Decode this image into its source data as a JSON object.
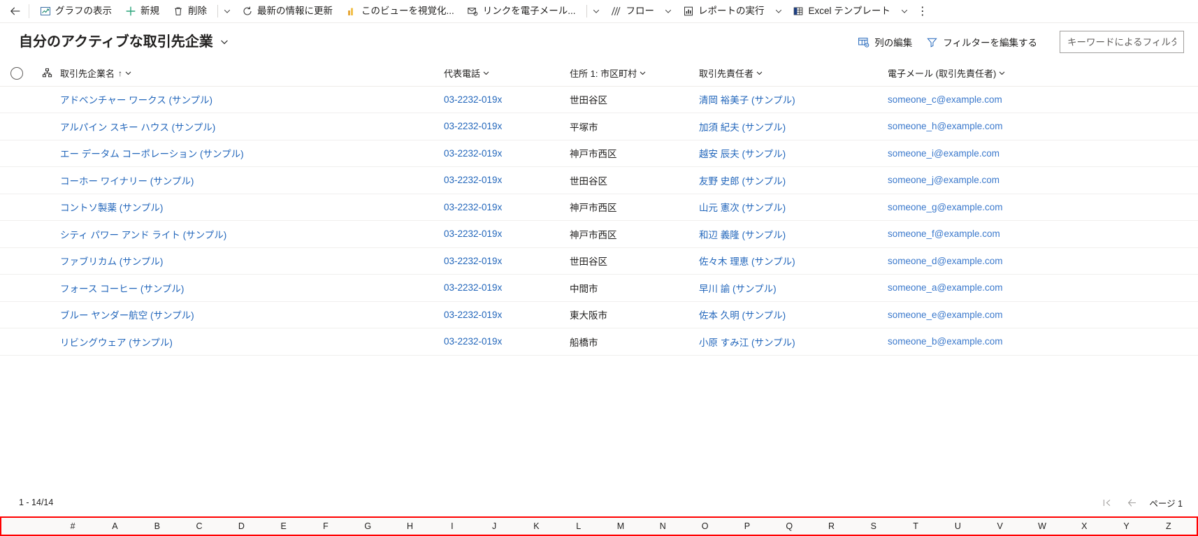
{
  "command_bar": {
    "back_icon": "back-arrow-icon",
    "items": [
      {
        "icon": "chart-icon",
        "label": "グラフの表示",
        "caret": false
      },
      {
        "icon": "plus-icon",
        "label": "新規",
        "caret": false
      },
      {
        "icon": "trash-icon",
        "label": "削除",
        "caret": true
      },
      {
        "icon": "refresh-icon",
        "label": "最新の情報に更新",
        "caret": false
      },
      {
        "icon": "powerbi-icon",
        "label": "このビューを視覚化...",
        "caret": false
      },
      {
        "icon": "email-link-icon",
        "label": "リンクを電子メール...",
        "caret": true
      },
      {
        "icon": "flow-icon",
        "label": "フロー",
        "caret": true
      },
      {
        "icon": "report-icon",
        "label": "レポートの実行",
        "caret": true
      },
      {
        "icon": "excel-icon",
        "label": "Excel テンプレート",
        "caret": true
      }
    ],
    "overflow_label": "⋮"
  },
  "view_header": {
    "title": "自分のアクティブな取引先企業",
    "title_caret_icon": "chevron-down-icon",
    "edit_columns": {
      "icon": "edit-columns-icon",
      "label": "列の編集"
    },
    "edit_filters": {
      "icon": "filter-icon",
      "label": "フィルターを編集する"
    },
    "quick_filter": {
      "value": "",
      "placeholder": "キーワードによるフィルタ"
    }
  },
  "grid": {
    "select_all_icon": "select-all-circle-icon",
    "hierarchy_icon": "hierarchy-icon",
    "columns": [
      {
        "key": "name",
        "label": "取引先企業名",
        "sorted": "asc"
      },
      {
        "key": "phone",
        "label": "代表電話"
      },
      {
        "key": "city",
        "label": "住所 1: 市区町村"
      },
      {
        "key": "contact",
        "label": "取引先責任者"
      },
      {
        "key": "email",
        "label": "電子メール (取引先責任者)"
      }
    ],
    "sort_asc_glyph": "↑",
    "rows": [
      {
        "name": "アドベンチャー ワークス (サンプル)",
        "phone": "03-2232-019x",
        "city": "世田谷区",
        "contact": "清岡 裕美子 (サンプル)",
        "email": "someone_c@example.com"
      },
      {
        "name": "アルパイン スキー ハウス (サンプル)",
        "phone": "03-2232-019x",
        "city": "平塚市",
        "contact": "加須 紀夫 (サンプル)",
        "email": "someone_h@example.com"
      },
      {
        "name": "エー データム コーポレーション (サンプル)",
        "phone": "03-2232-019x",
        "city": "神戸市西区",
        "contact": "越安 辰夫 (サンプル)",
        "email": "someone_i@example.com"
      },
      {
        "name": "コーホー ワイナリー (サンプル)",
        "phone": "03-2232-019x",
        "city": "世田谷区",
        "contact": "友野 史郎 (サンプル)",
        "email": "someone_j@example.com"
      },
      {
        "name": "コントソ製薬 (サンプル)",
        "phone": "03-2232-019x",
        "city": "神戸市西区",
        "contact": "山元 憲次 (サンプル)",
        "email": "someone_g@example.com"
      },
      {
        "name": "シティ パワー アンド ライト (サンプル)",
        "phone": "03-2232-019x",
        "city": "神戸市西区",
        "contact": "和辺 義隆 (サンプル)",
        "email": "someone_f@example.com"
      },
      {
        "name": "ファブリカム (サンプル)",
        "phone": "03-2232-019x",
        "city": "世田谷区",
        "contact": "佐々木 理恵 (サンプル)",
        "email": "someone_d@example.com"
      },
      {
        "name": "フォース コーヒー (サンプル)",
        "phone": "03-2232-019x",
        "city": "中間市",
        "contact": "早川 諭 (サンプル)",
        "email": "someone_a@example.com"
      },
      {
        "name": "ブルー ヤンダー航空 (サンプル)",
        "phone": "03-2232-019x",
        "city": "東大阪市",
        "contact": "佐本 久明 (サンプル)",
        "email": "someone_e@example.com"
      },
      {
        "name": "リビングウェア (サンプル)",
        "phone": "03-2232-019x",
        "city": "船橋市",
        "contact": "小原 すみ江 (サンプル)",
        "email": "someone_b@example.com"
      }
    ]
  },
  "footer": {
    "record_count": "1 - 14/14",
    "first_page_icon": "first-page-icon",
    "prev_page_icon": "prev-page-icon",
    "page_label": "ページ 1"
  },
  "alpha_filter": {
    "items": [
      "#",
      "A",
      "B",
      "C",
      "D",
      "E",
      "F",
      "G",
      "H",
      "I",
      "J",
      "K",
      "L",
      "M",
      "N",
      "O",
      "P",
      "Q",
      "R",
      "S",
      "T",
      "U",
      "V",
      "W",
      "X",
      "Y",
      "Z"
    ],
    "highlight_color": "#ff0000"
  }
}
